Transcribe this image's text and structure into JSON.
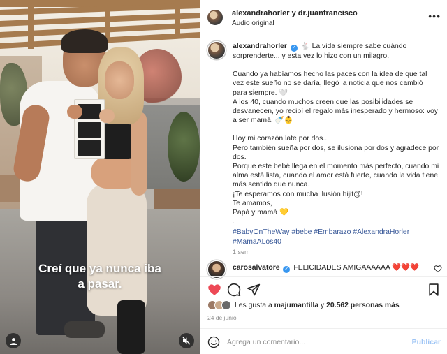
{
  "post": {
    "header": {
      "user1": "alexandrahorler",
      "connector": "y",
      "user2": "dr.juanfrancisco",
      "audio": "Audio original",
      "more_icon": "more-dots-icon"
    },
    "caption": {
      "username": "alexandrahorler",
      "lines": [
        "🐇 La vida siempre sabe cuándo sorprenderte... y esta vez lo hizo con un milagro.",
        "Cuando ya habíamos hecho las paces con la idea de que tal vez este sueño no se daría, llegó la noticia que nos cambió para siempre. 🤍\nA los 40, cuando muchos creen que las posibilidades se desvanecen, yo recibí el regalo más inesperado y hermoso: voy a ser mamá. 🍼👶",
        "Hoy mi corazón late por dos...\nPero también sueña por dos, se ilusiona por dos y agradece por dos.\nPorque este bebé llega en el momento más perfecto, cuando mi alma está lista, cuando el amor está fuerte, cuando la vida tiene más sentido que nunca.\n¡Te esperamos con mucha ilusión hijit@!\nTe amamos,\nPapá y mamá 💛\n."
      ],
      "hashtags": "#BabyOnTheWay #bebe #Embarazo #AlexandraHorler #MamaALos40",
      "time_ago": "1 sem"
    },
    "comment": {
      "username": "carosalvatore",
      "text": "FELICIDADES AMIGAAAAAA ❤️❤️❤️"
    },
    "likes": {
      "prefix": "Les gusta a",
      "user": "majumantilla",
      "middle": "y",
      "count": "20.562 personas más"
    },
    "date": "24 de junio",
    "add_comment": {
      "placeholder": "Agrega un comentario...",
      "post_label": "Publicar"
    },
    "media": {
      "overlay_line1": "Creí que ya nunca iba",
      "overlay_line2": "a pasar."
    }
  },
  "colors": {
    "like_red": "#ed4956",
    "link_blue": "#385898",
    "verified_blue": "#3897f0",
    "publish_blue_disabled": "#9ec5f5"
  }
}
